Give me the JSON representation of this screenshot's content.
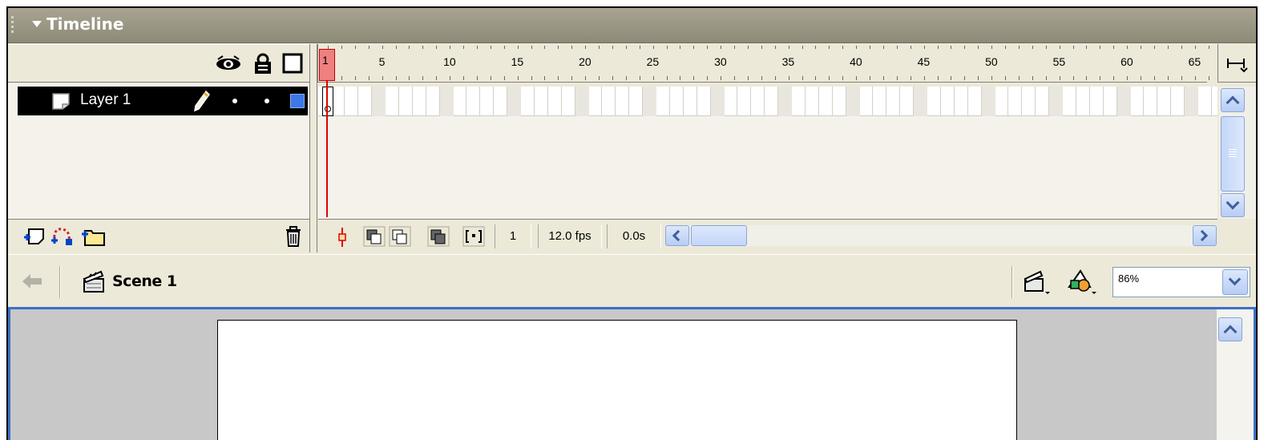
{
  "panel": {
    "title": "Timeline"
  },
  "layer_header": {
    "icons": [
      "eye-icon",
      "lock-icon",
      "outline-icon"
    ]
  },
  "ruler": {
    "labels": [
      "1",
      "5",
      "10",
      "15",
      "20",
      "25",
      "30",
      "35",
      "40",
      "45",
      "50",
      "55",
      "60",
      "65"
    ]
  },
  "layers": [
    {
      "name": "Layer 1",
      "icons": [
        "layer-icon",
        "pencil-icon"
      ],
      "color": "#3c78e6"
    }
  ],
  "frame_controls": {
    "current_frame": "1",
    "fps": "12.0 fps",
    "elapsed": "0.0s"
  },
  "scene": {
    "name": "Scene 1",
    "zoom": "86%"
  },
  "colors": {
    "accent": "#3c6fc8",
    "playhead": "#e00000",
    "layer_selected": "#000000"
  }
}
